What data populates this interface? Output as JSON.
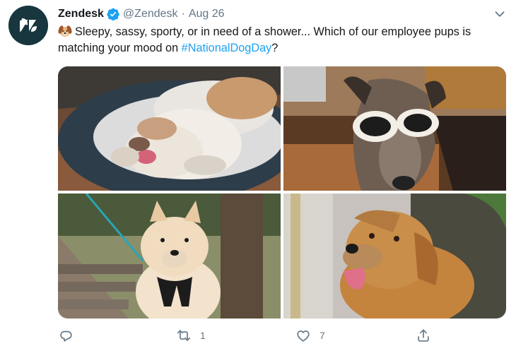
{
  "tweet": {
    "author_name": "Zendesk",
    "handle": "@Zendesk",
    "separator": "·",
    "date": "Aug 26",
    "text_before": "Sleepy, sassy, sporty, or in need of a shower... Which of our employee pups is matching your mood on ",
    "hashtag": "#NationalDogDay",
    "text_after": "?",
    "emoji": "dog-face",
    "retweet_count": "1",
    "like_count": "7"
  },
  "colors": {
    "accent": "#1da1f2",
    "secondary_text": "#657786",
    "avatar_bg": "#17363e"
  },
  "icons": [
    "zendesk-logo",
    "verified-badge-icon",
    "chevron-down-icon",
    "reply-icon",
    "retweet-icon",
    "like-icon",
    "share-icon"
  ]
}
